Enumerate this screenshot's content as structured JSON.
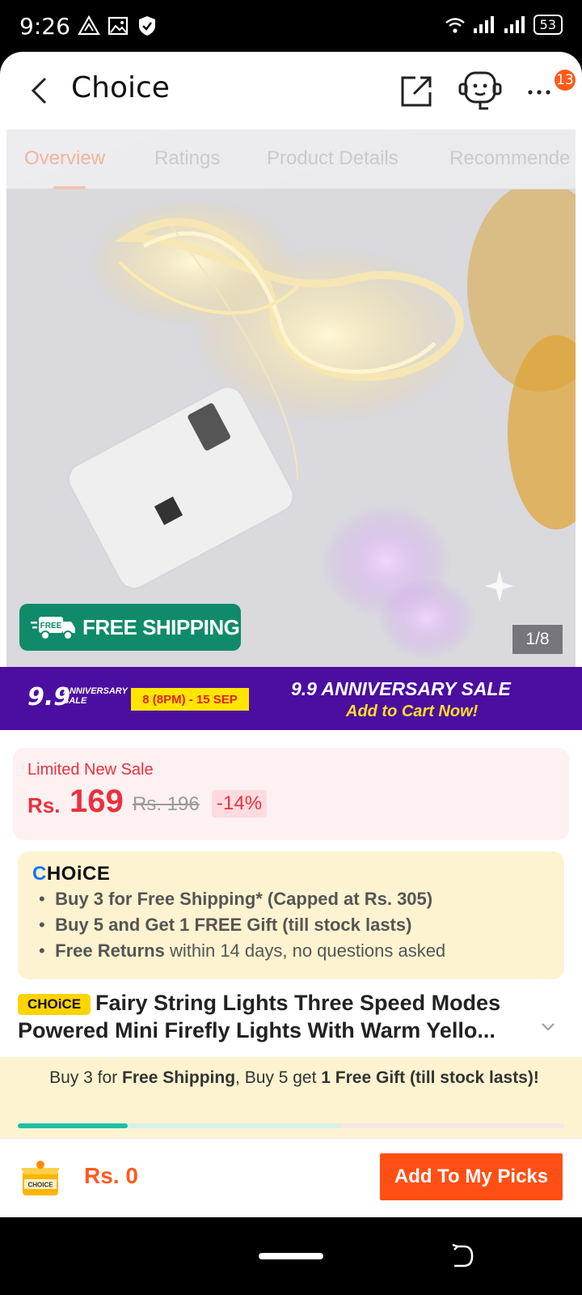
{
  "status_bar": {
    "time": "9:26",
    "battery": "53"
  },
  "header": {
    "title": "Choice",
    "badge_count": "13"
  },
  "gallery": {
    "tabs": [
      {
        "label": "Overview",
        "active": true
      },
      {
        "label": "Ratings",
        "active": false
      },
      {
        "label": "Product Details",
        "active": false
      },
      {
        "label": "Recommende",
        "active": false
      }
    ],
    "free_shipping_icon_text": "FREE",
    "free_shipping": "FREE SHIPPING",
    "counter": "1/8"
  },
  "promo": {
    "logo_number": "9.9",
    "logo_sub": "ANNIVERSARY SALE",
    "date_range": "8 (8PM) - 15 SEP",
    "title": "9.9 ANNIVERSARY SALE",
    "cta": "Add to Cart Now!"
  },
  "price_card": {
    "label": "Limited New Sale",
    "currency": "Rs.",
    "price": "169",
    "original_price": "Rs. 196",
    "discount": "-14%"
  },
  "choice_card": {
    "logo_c": "C",
    "logo_rest": "HOiCE",
    "benefits": [
      {
        "bold": "Buy 3 for  Free Shipping* (Capped at Rs. 305)",
        "rest": ""
      },
      {
        "bold": "Buy 5 and Get 1 FREE Gift (till stock lasts)",
        "rest": ""
      },
      {
        "bold": "Free Returns",
        "rest": " within 14 days, no questions asked"
      }
    ]
  },
  "product": {
    "tag": "CHOiCE",
    "title_line1": "Fairy String Lights Three Speed Modes",
    "title_line2": "Powered Mini Firefly Lights With Warm Yello..."
  },
  "bundle": {
    "p1": "Buy 3 for ",
    "b1": "Free Shipping",
    "p2": ", Buy 5 get ",
    "b2": "1 Free Gift (till stock lasts)!",
    "progress_items": 1,
    "progress_target": 5
  },
  "bottom_bar": {
    "cart_label": "CHOICE",
    "total": "Rs. 0",
    "button": "Add To My Picks"
  },
  "colors": {
    "accent": "#ff4f14",
    "price": "#e8323c",
    "promo": "#4b0ea0",
    "free_ship": "#0f8b69"
  }
}
